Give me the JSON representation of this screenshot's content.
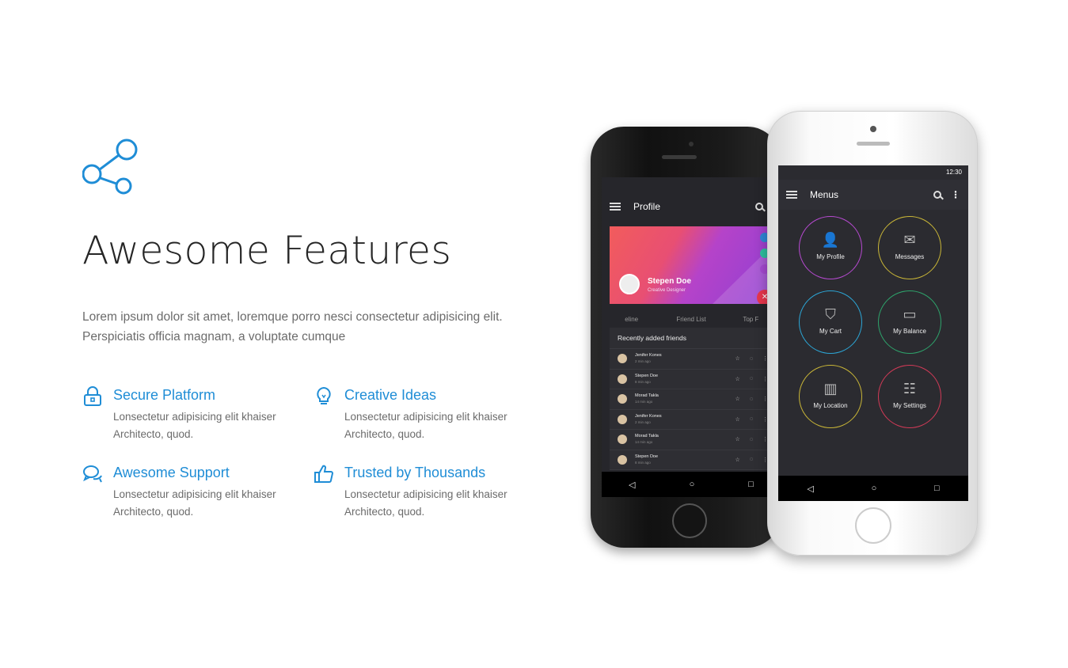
{
  "hero": {
    "headline": "Awesome Features",
    "intro_line1": "Lorem ipsum dolor sit amet, loremque porro nesci consectetur adipisicing elit.",
    "intro_line2": "Perspiciatis officia magnam, a voluptate cumque"
  },
  "features": [
    {
      "title": "Secure Platform",
      "desc": "Lonsectetur adipisicing elit khaiser Architecto, quod.",
      "icon": "lock-icon"
    },
    {
      "title": "Creative Ideas",
      "desc": "Lonsectetur adipisicing elit khaiser Architecto, quod.",
      "icon": "lightbulb-icon"
    },
    {
      "title": "Awesome Support",
      "desc": "Lonsectetur adipisicing elit khaiser Architecto, quod.",
      "icon": "chat-icon"
    },
    {
      "title": "Trusted by Thousands",
      "desc": "Lonsectetur adipisicing elit khaiser Architecto, quod.",
      "icon": "thumbs-up-icon"
    }
  ],
  "colors": {
    "accent": "#1f8dd6",
    "heading": "#262626",
    "body": "#6b6b6b"
  },
  "black_phone": {
    "app_title": "Profile",
    "profile_name": "Stepen Doe",
    "profile_role": "Creative Designer",
    "tabs": [
      "eline",
      "Friend List",
      "Top F"
    ],
    "card_title": "Recently added friends",
    "friends": [
      {
        "name": "Jenifer Kones",
        "time": "2 min ago"
      },
      {
        "name": "Stepen Doe",
        "time": "8 min ago"
      },
      {
        "name": "Morad Takla",
        "time": "14 min ago"
      },
      {
        "name": "Jenifer Kones",
        "time": "2 min ago"
      },
      {
        "name": "Morad Takla",
        "time": "14 min ago"
      },
      {
        "name": "Stepen Doe",
        "time": "8 min ago"
      }
    ]
  },
  "white_phone": {
    "status_time": "12:30",
    "app_title": "Menus",
    "menu_items": [
      {
        "label": "My Profile",
        "color": "#b74ad1"
      },
      {
        "label": "Messages",
        "color": "#c9b637"
      },
      {
        "label": "My Cart",
        "color": "#2ca6d6"
      },
      {
        "label": "My Balance",
        "color": "#2ea36b"
      },
      {
        "label": "My Location",
        "color": "#c9b637"
      },
      {
        "label": "My Settings",
        "color": "#d23a57"
      }
    ]
  }
}
